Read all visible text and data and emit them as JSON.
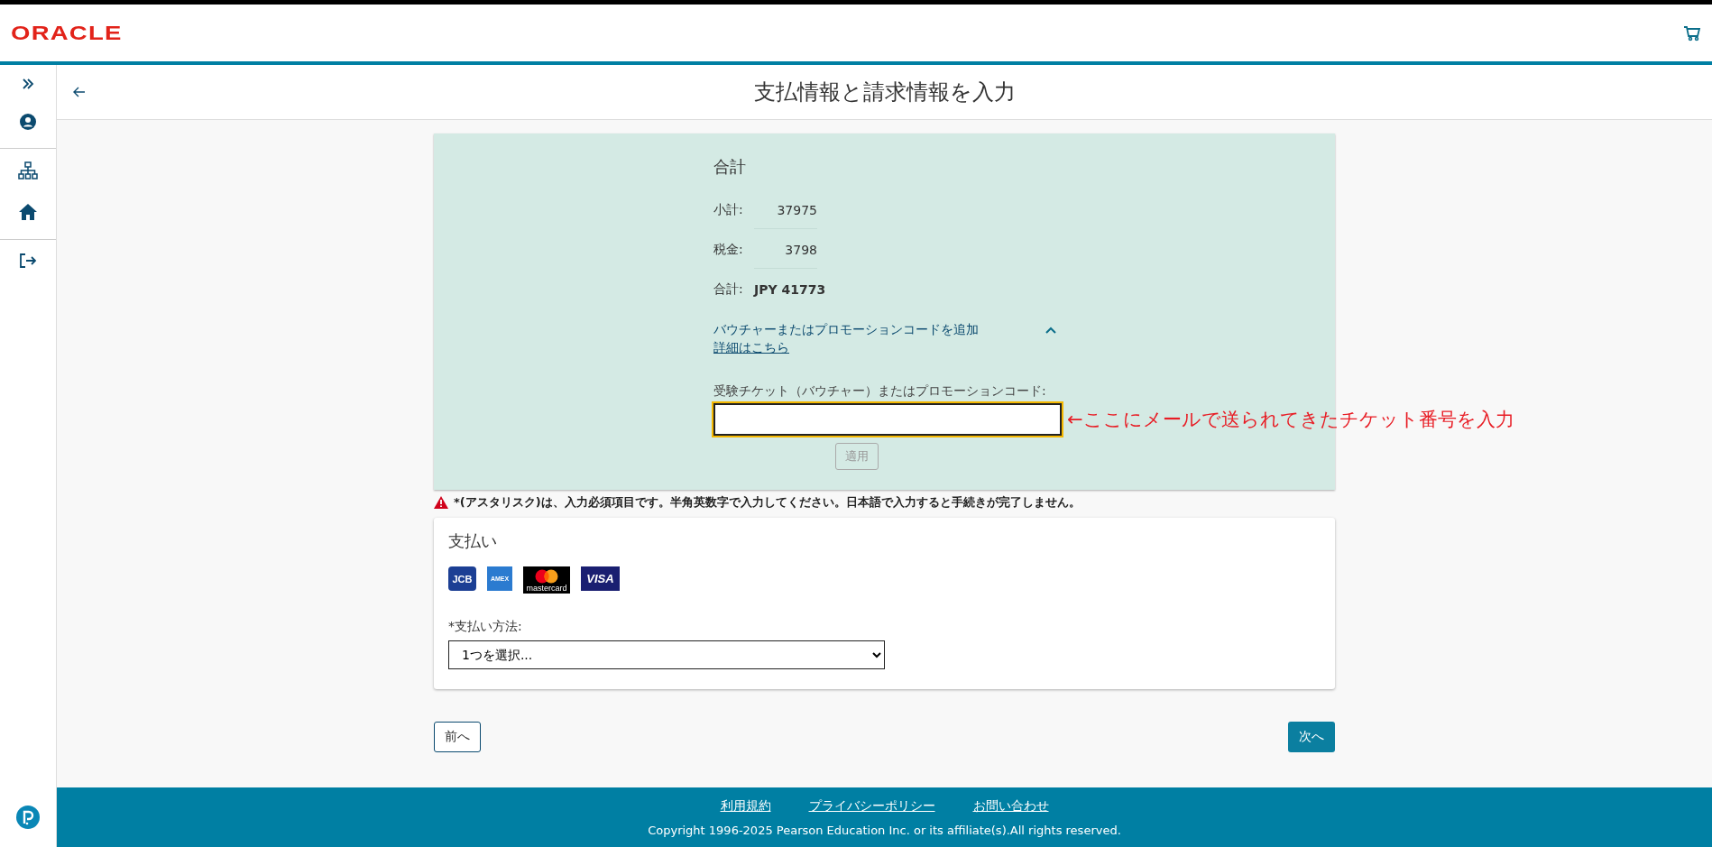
{
  "header": {
    "logo": "ORACLE"
  },
  "page_title": "支払情報と請求情報を入力",
  "summary": {
    "heading": "合計",
    "rows": [
      {
        "kind": "line",
        "label": "小計:",
        "value": "37975"
      },
      {
        "kind": "line",
        "label": "税金:",
        "value": "3798"
      },
      {
        "kind": "total",
        "label": "合計:",
        "value": "JPY 41773"
      }
    ],
    "voucher": {
      "toggle": "バウチャーまたはプロモーションコードを追加",
      "expanded": true,
      "details_link": "詳細はこちら",
      "field_label": "受験チケット（バウチャー）またはプロモーションコード:",
      "annotation": "←ここにメールで送られてきたチケット番号を入力",
      "apply_button": {
        "label": "適用",
        "disabled": true
      }
    }
  },
  "warning": "*(アスタリスク)は、入力必須項目です。半角英数字で入力してください。日本語で入力すると手続きが完了しません。",
  "payment": {
    "heading": "支払い",
    "card_logos": [
      {
        "kind": "jcb",
        "label": "JCB"
      },
      {
        "kind": "amex",
        "label": "AMEX"
      },
      {
        "kind": "mastercard",
        "label": "mastercard"
      },
      {
        "kind": "visa",
        "label": "VISA"
      }
    ],
    "method_label": "*支払い方法:",
    "method_value": "1つを選択..."
  },
  "buttons": {
    "back": "前へ",
    "next": "次へ"
  },
  "footer": {
    "links": [
      "利用規約",
      "プライバシーポリシー",
      "お問い合わせ"
    ],
    "copyright": "Copyright 1996-2025 Pearson Education Inc. or its affiliate(s).All rights reserved."
  }
}
